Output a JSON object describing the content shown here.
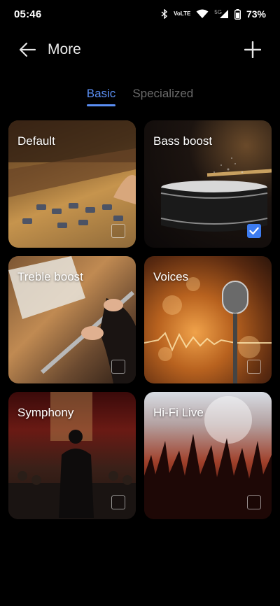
{
  "status_bar": {
    "time": "05:46",
    "volte_top": "Vo",
    "volte_bottom": "LTE",
    "network": "5G",
    "battery": "73%"
  },
  "header": {
    "title": "More",
    "back_icon": "arrow-left-icon",
    "add_icon": "plus-icon"
  },
  "tabs": [
    {
      "label": "Basic",
      "active": true
    },
    {
      "label": "Specialized",
      "active": false
    }
  ],
  "cards": [
    {
      "label": "Default",
      "checked": false,
      "image": "mixing-console"
    },
    {
      "label": "Bass boost",
      "checked": true,
      "image": "snare-drum"
    },
    {
      "label": "Treble boost",
      "checked": false,
      "image": "flute-player"
    },
    {
      "label": "Voices",
      "checked": false,
      "image": "microphone"
    },
    {
      "label": "Symphony",
      "checked": false,
      "image": "conductor-orchestra"
    },
    {
      "label": "Hi-Fi Live",
      "checked": false,
      "image": "concert-crowd"
    }
  ],
  "colors": {
    "accent": "#5b8ff4",
    "checkbox_checked": "#3d7cf0",
    "background": "#000000"
  }
}
